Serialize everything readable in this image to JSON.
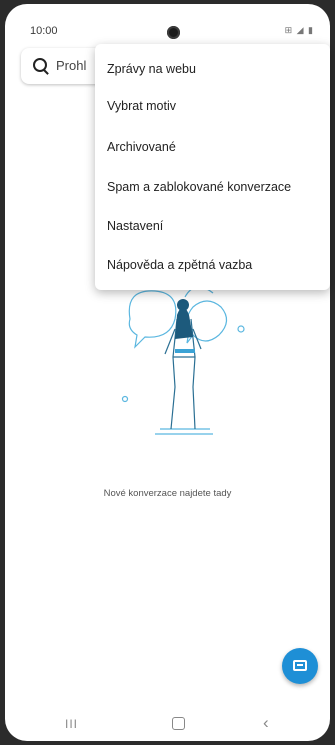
{
  "status_bar": {
    "time": "10:00",
    "icons": "⊞ ◢ ▮"
  },
  "search": {
    "placeholder": "Prohl"
  },
  "menu": {
    "items": [
      {
        "label": "Zprávy na webu"
      },
      {
        "label": "Vybrat motiv"
      },
      {
        "label": "Archivované"
      },
      {
        "label": "Spam a zablokované konverzace"
      },
      {
        "label": "Nastavení"
      },
      {
        "label": "Nápověda a zpětná vazba"
      }
    ]
  },
  "empty_state": {
    "message": "Nové konverzace najdete tady"
  },
  "fab": {
    "icon": "new-message-icon",
    "color": "#1e8fd6"
  },
  "nav_bar": {
    "recent": "III",
    "back": "‹"
  }
}
